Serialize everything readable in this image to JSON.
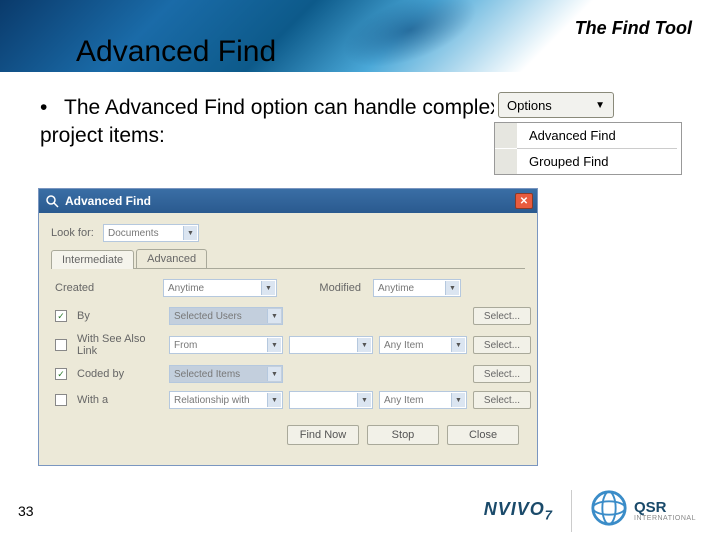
{
  "header": {
    "section_title": "The Find Tool",
    "page_title": "Advanced Find"
  },
  "bullet": {
    "text": "The Advanced Find option can handle complex criteria for finding project items:"
  },
  "options": {
    "button_label": "Options",
    "menu": {
      "item1": "Advanced Find",
      "item2": "Grouped Find"
    }
  },
  "dialog": {
    "title": "Advanced Find",
    "look_for_label": "Look for:",
    "look_for_value": "Documents",
    "tabs": {
      "intermediate": "Intermediate",
      "advanced": "Advanced"
    },
    "row_created_label": "Created",
    "row_modified_label": "Modified",
    "anytime": "Anytime",
    "rows": [
      {
        "checked": true,
        "label": "By",
        "field1": "Selected Users",
        "field2": "",
        "field3": "",
        "action": "Select..."
      },
      {
        "checked": false,
        "label": "With See Also Link",
        "field1": "From",
        "field2": "",
        "field3": "Any Item",
        "action": "Select..."
      },
      {
        "checked": true,
        "label": "Coded by",
        "field1": "Selected Items",
        "field2": "",
        "field3": "",
        "action": "Select..."
      },
      {
        "checked": false,
        "label": "With a",
        "field1": "Relationship with",
        "field2": "",
        "field3": "Any Item",
        "action": "Select..."
      }
    ],
    "btn_find": "Find Now",
    "btn_stop": "Stop",
    "btn_close": "Close"
  },
  "footer": {
    "page_number": "33",
    "logo1": "NVIVO",
    "logo1_sub": "7",
    "logo2": "QSR",
    "logo2_sub": "INTERNATIONAL"
  }
}
